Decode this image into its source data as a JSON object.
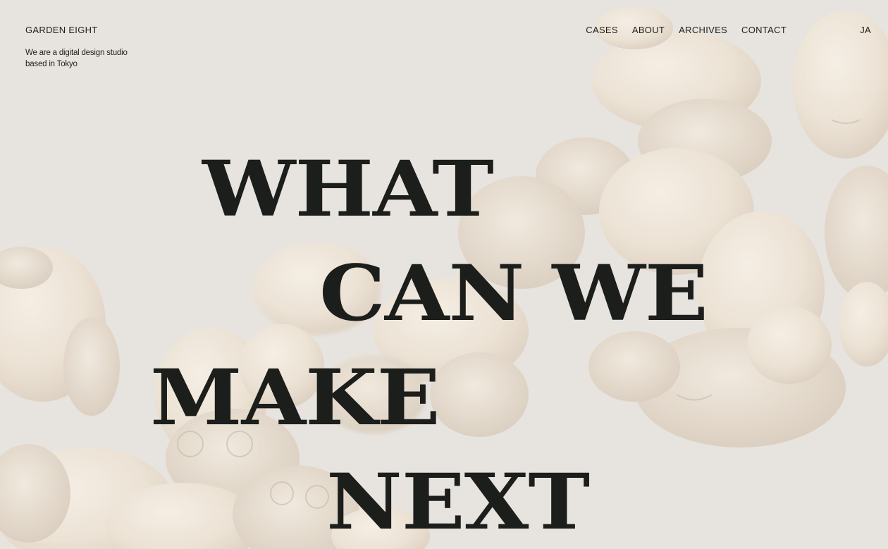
{
  "header": {
    "brand": "GARDEN EIGHT",
    "tagline_line1": "We are a digital design studio",
    "tagline_line2": "based in Tokyo"
  },
  "nav": {
    "items": [
      {
        "label": "CASES"
      },
      {
        "label": "ABOUT"
      },
      {
        "label": "ARCHIVES"
      },
      {
        "label": "CONTACT"
      }
    ],
    "language": "JA"
  },
  "hero": {
    "line1": "WHAT",
    "line2": "CAN WE",
    "line3": "MAKE",
    "line4": "NEXT"
  },
  "colors": {
    "background": "#e7e3de",
    "text": "#1e201e",
    "figure": "#efe6da"
  }
}
